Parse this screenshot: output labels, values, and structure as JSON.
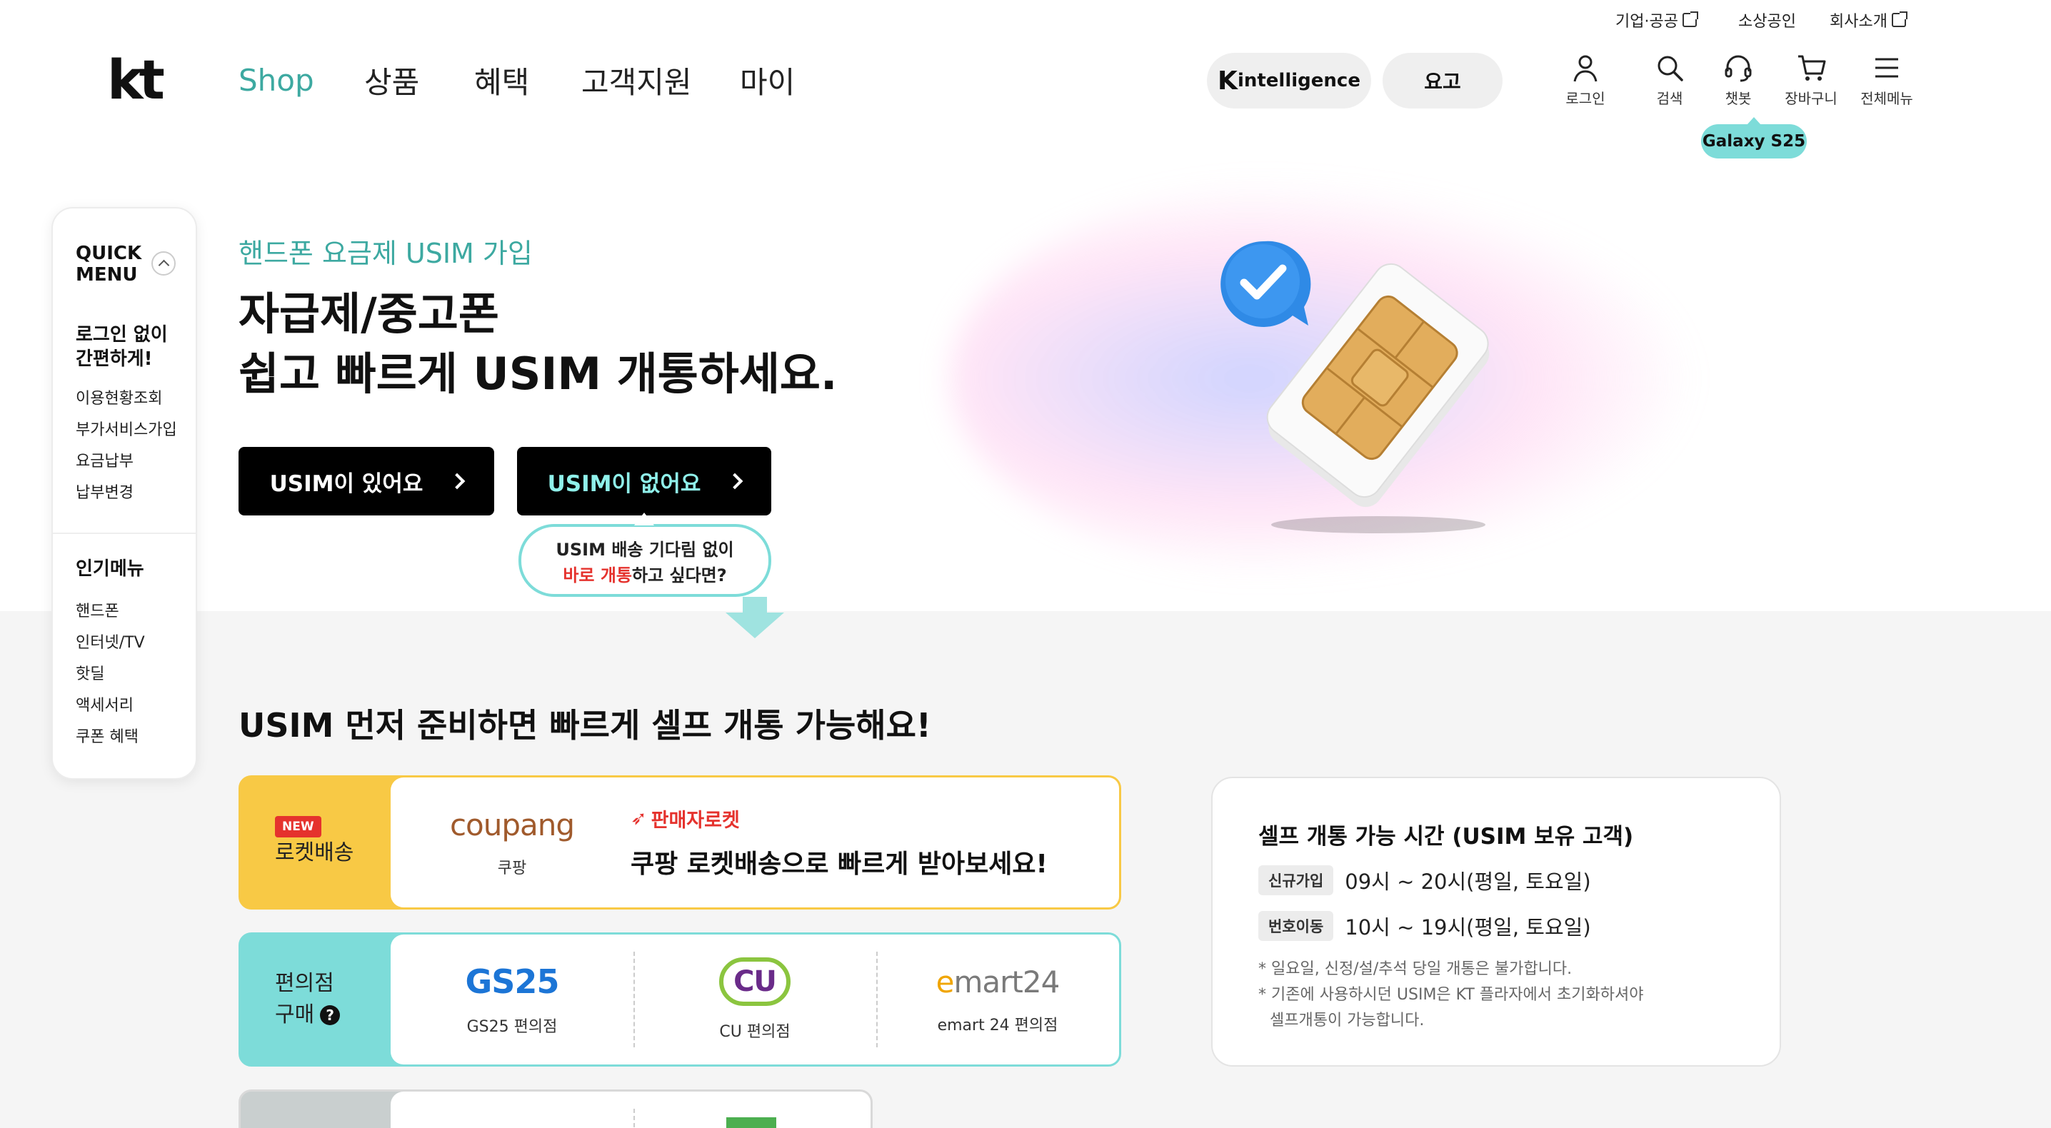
{
  "utility_nav": {
    "biz": "기업·공공",
    "small_biz": "소상공인",
    "company": "회사소개"
  },
  "header": {
    "logo": "kt",
    "gnb": [
      "Shop",
      "상품",
      "혜택",
      "고객지원",
      "마이"
    ],
    "pill_intelligence_k": "K",
    "pill_intelligence": "intelligence",
    "pill_plan": "요고",
    "icons": [
      {
        "icon": "user-icon",
        "label": "로그인"
      },
      {
        "icon": "search-icon",
        "label": "검색"
      },
      {
        "icon": "headset-icon",
        "label": "챗봇"
      },
      {
        "icon": "cart-icon",
        "label": "장바구니"
      },
      {
        "icon": "menu-icon",
        "label": "전체메뉴"
      }
    ],
    "chatbot_tooltip": "Galaxy S25"
  },
  "quick_menu": {
    "title_line1": "QUICK",
    "title_line2": "MENU",
    "group1_title_line1": "로그인 없이",
    "group1_title_line2": "간편하게!",
    "group1_items": [
      "이용현황조회",
      "부가서비스가입",
      "요금납부",
      "납부변경"
    ],
    "group2_title": "인기메뉴",
    "group2_items": [
      "핸드폰",
      "인터넷/TV",
      "핫딜",
      "액세서리",
      "쿠폰 혜택"
    ]
  },
  "hero": {
    "kicker": "핸드폰 요금제 USIM 가입",
    "title_line1": "자급제/중고폰",
    "title_line2": "쉽고 빠르게 USIM 개통하세요.",
    "btn_have": "USIM이 있어요",
    "btn_nothave": "USIM이 없어요",
    "bubble_line1": "USIM 배송 기다림 없이",
    "bubble_red": "바로 개통",
    "bubble_rest": "하고 싶다면?"
  },
  "section": {
    "title": "USIM 먼저 준비하면 빠르게 셀프 개통 가능해요!",
    "coupang": {
      "badge": "NEW",
      "side_label": "로켓배송",
      "logo": "coupang",
      "logo_sub": "쿠팡",
      "rocket_tag": "판매자로켓",
      "desc": "쿠팡 로켓배송으로 빠르게 받아보세요!"
    },
    "cvs": {
      "side_line1": "편의점",
      "side_line2": "구매",
      "stores": [
        {
          "logo": "GS25",
          "label": "GS25 편의점"
        },
        {
          "logo": "CU",
          "label": "CU 편의점"
        },
        {
          "logo_e": "e",
          "logo": "mart24",
          "label": "emart 24 편의점"
        }
      ]
    }
  },
  "info_card": {
    "title": "셀프 개통 가능 시간 (USIM 보유 고객)",
    "rows": [
      {
        "badge": "신규가입",
        "time": "09시 ~ 20시(평일, 토요일)"
      },
      {
        "badge": "번호이동",
        "time": "10시 ~ 19시(평일, 토요일)"
      }
    ],
    "note1": "* 일요일, 신정/설/추석 당일 개통은 불가합니다.",
    "note2": "* 기존에 사용하시던 USIM은 KT 플라자에서 초기화하셔야",
    "note3": "셀프개통이 가능합니다."
  },
  "colors": {
    "accent_teal": "#3da9a1",
    "mint": "#7ddcd9",
    "coupang_side": "#f8c945",
    "cvs_side": "#7ddcd9",
    "red": "#e5322d"
  }
}
